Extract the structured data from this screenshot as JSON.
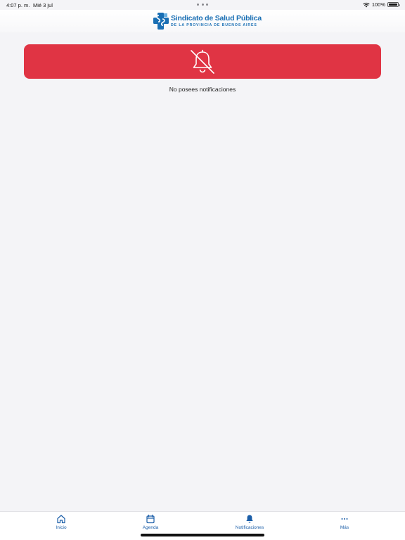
{
  "status_bar": {
    "time": "4:07 p. m.",
    "date": "Mié 3 jul",
    "battery": "100%",
    "battery_level": 1.0
  },
  "header": {
    "logo_title": "Sindicato de Salud Pública",
    "logo_subtitle": "DE LA PROVINCIA DE BUENOS AIRES"
  },
  "notifications": {
    "empty_icon": "bell-slash-icon",
    "empty_message": "No posees notificaciones"
  },
  "tabs": [
    {
      "label": "Inicio",
      "icon": "home-icon"
    },
    {
      "label": "Agenda",
      "icon": "calendar-icon"
    },
    {
      "label": "Notificaciones",
      "icon": "bell-icon",
      "active": true
    },
    {
      "label": "Más",
      "icon": "more-icon"
    }
  ],
  "colors": {
    "banner": "#e03444",
    "accent": "#1b5ea8",
    "background": "#f4f4f7"
  }
}
